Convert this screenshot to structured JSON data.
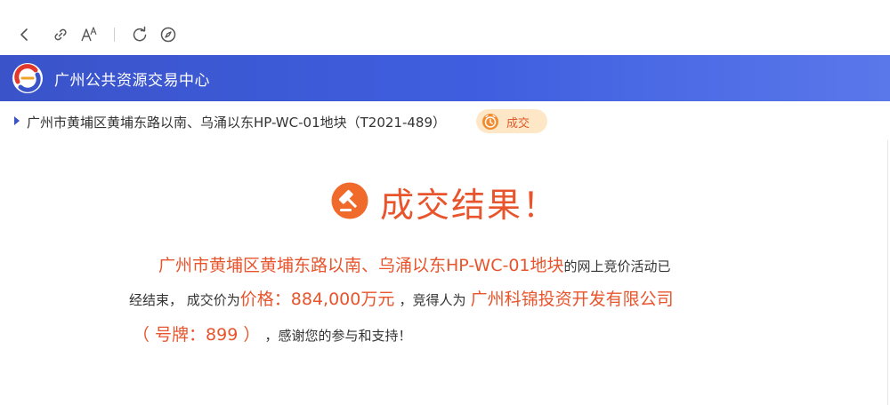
{
  "toolbar": {
    "icons": [
      "back-icon",
      "link-icon",
      "font-size-icon",
      "refresh-icon",
      "compass-icon"
    ]
  },
  "header": {
    "title": "广州公共资源交易中心",
    "color": "#3f5fe0"
  },
  "breadcrumb": {
    "text": "广州市黄埔区黄埔东路以南、乌涌以东HP-WC-01地块（T2021-489）",
    "status": "成交"
  },
  "result": {
    "title": "成交结果！",
    "line1_hl": "广州市黄埔区黄埔东路以南、乌涌以东HP-WC-01地块",
    "line1_text": "的网上竞价活动已",
    "line2_text_a": "经结束， 成交价为",
    "line2_price": "价格：884,000万元",
    "line2_text_b": "，竞得人为",
    "line2_winner": "广州科锦投资开发有限公司",
    "line3_plate": "（ 号牌：899 ）",
    "line3_text": "，感谢您的参与和支持！",
    "accent": "#e8542c"
  }
}
